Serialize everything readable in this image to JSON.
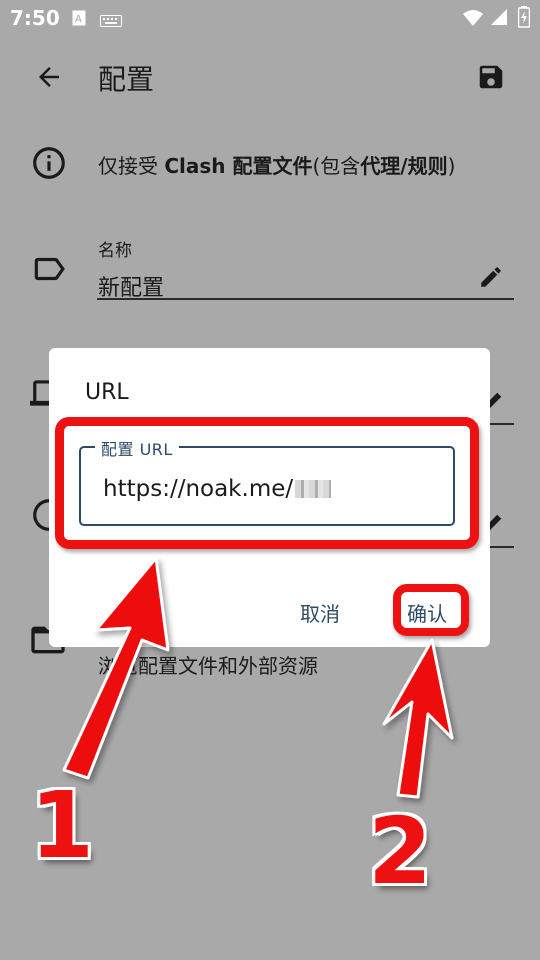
{
  "status_bar": {
    "time": "7:50",
    "icons": [
      "font-a-icon",
      "keyboard-icon",
      "wifi-icon",
      "signal-icon",
      "battery-icon"
    ]
  },
  "app_bar": {
    "title": "配置",
    "back_icon": "arrow-back-icon",
    "save_icon": "save-icon"
  },
  "info": {
    "prefix": "仅接受 ",
    "strong1": "Clash 配置文件",
    "middle": "(包含",
    "strong2": "代理/规则",
    "suffix": ")"
  },
  "name_field": {
    "label": "名称",
    "value": "新配置"
  },
  "browse": {
    "subtitle": "浏览配置文件和外部资源"
  },
  "dialog": {
    "title": "URL",
    "input_label": "配置 URL",
    "input_value": "https://noak.me/",
    "cancel_label": "取消",
    "confirm_label": "确认"
  },
  "annotations": {
    "step1": "1",
    "step2": "2",
    "color": "#ee1111"
  },
  "colors": {
    "scrim_background": "#a9a9a9",
    "dialog_accent": "#2d4a68"
  }
}
